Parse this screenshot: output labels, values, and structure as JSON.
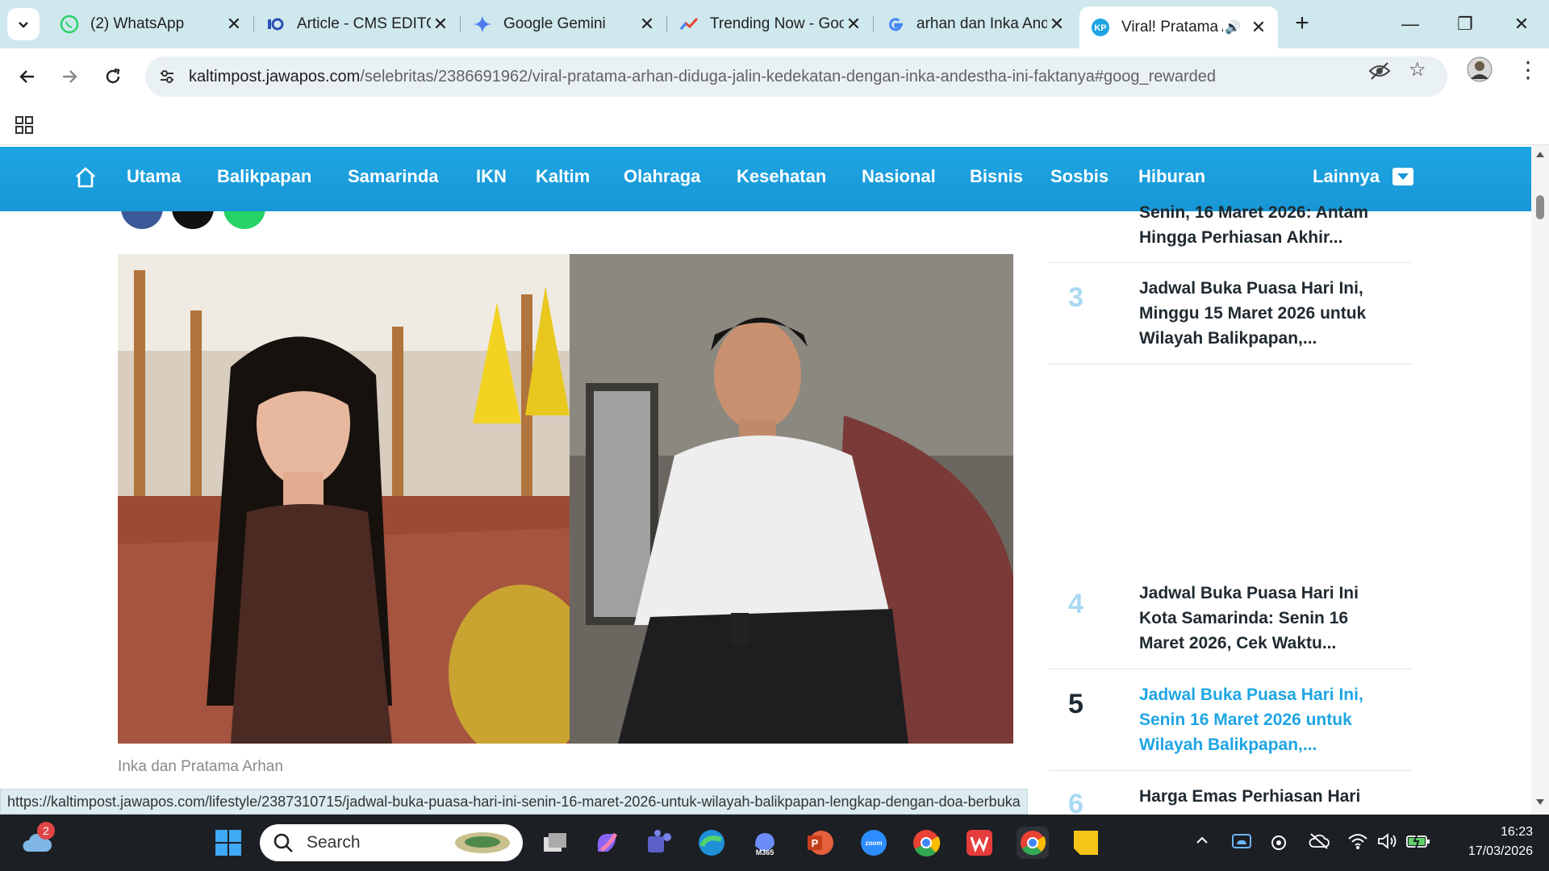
{
  "browser": {
    "tabs": [
      {
        "title": "(2) WhatsApp",
        "icon": "whatsapp-icon"
      },
      {
        "title": "Article - CMS EDITOR",
        "icon": "cms-icon"
      },
      {
        "title": "Google Gemini",
        "icon": "gemini-icon"
      },
      {
        "title": "Trending Now - Google Trends",
        "icon": "trends-icon"
      },
      {
        "title": "arhan dan Inka Andestha",
        "icon": "google-icon"
      },
      {
        "title": "Viral! Pratama Arhan",
        "icon": "kaltimpost-icon"
      }
    ],
    "url_host": "kaltimpost.jawapos.com",
    "url_path": "/selebritas/2386691962/viral-pratama-arhan-diduga-jalin-kedekatan-dengan-inka-andestha-ini-faktanya#goog_rewarded"
  },
  "site_nav": {
    "items": [
      "Utama",
      "Balikpapan",
      "Samarinda",
      "IKN",
      "Kaltim",
      "Olahraga",
      "Kesehatan",
      "Nasional",
      "Bisnis",
      "Sosbis",
      "Hiburan"
    ],
    "more": "Lainnya"
  },
  "article": {
    "caption": "Inka dan Pratama Arhan"
  },
  "sidebar": {
    "items": [
      {
        "num": "",
        "title": "Senin, 16 Maret 2026: Antam Hingga Perhiasan Akhir..."
      },
      {
        "num": "3",
        "title": "Jadwal Buka Puasa Hari Ini, Minggu 15 Maret 2026 untuk Wilayah Balikpapan,..."
      },
      {
        "num": "4",
        "title": "Jadwal Buka Puasa Hari Ini Kota Samarinda: Senin 16 Maret 2026, Cek Waktu..."
      },
      {
        "num": "5",
        "title": "Jadwal Buka Puasa Hari Ini, Senin 16 Maret 2026 untuk Wilayah Balikpapan,..."
      },
      {
        "num": "6",
        "title": "Harga Emas Perhiasan Hari"
      }
    ]
  },
  "status_url": "https://kaltimpost.jawapos.com/lifestyle/2387310715/jadwal-buka-puasa-hari-ini-senin-16-maret-2026-untuk-wilayah-balikpapan-lengkap-dengan-doa-berbuka",
  "taskbar": {
    "search_placeholder": "Search",
    "weather_badge": "2",
    "time": "16:23",
    "date": "17/03/2026",
    "m365_label": "M365",
    "zoom_label": "zoom"
  },
  "colors": {
    "nav_blue": "#1ea5e3",
    "tab_strip": "#cfe8ee",
    "highlight": "#1ea5e3"
  }
}
